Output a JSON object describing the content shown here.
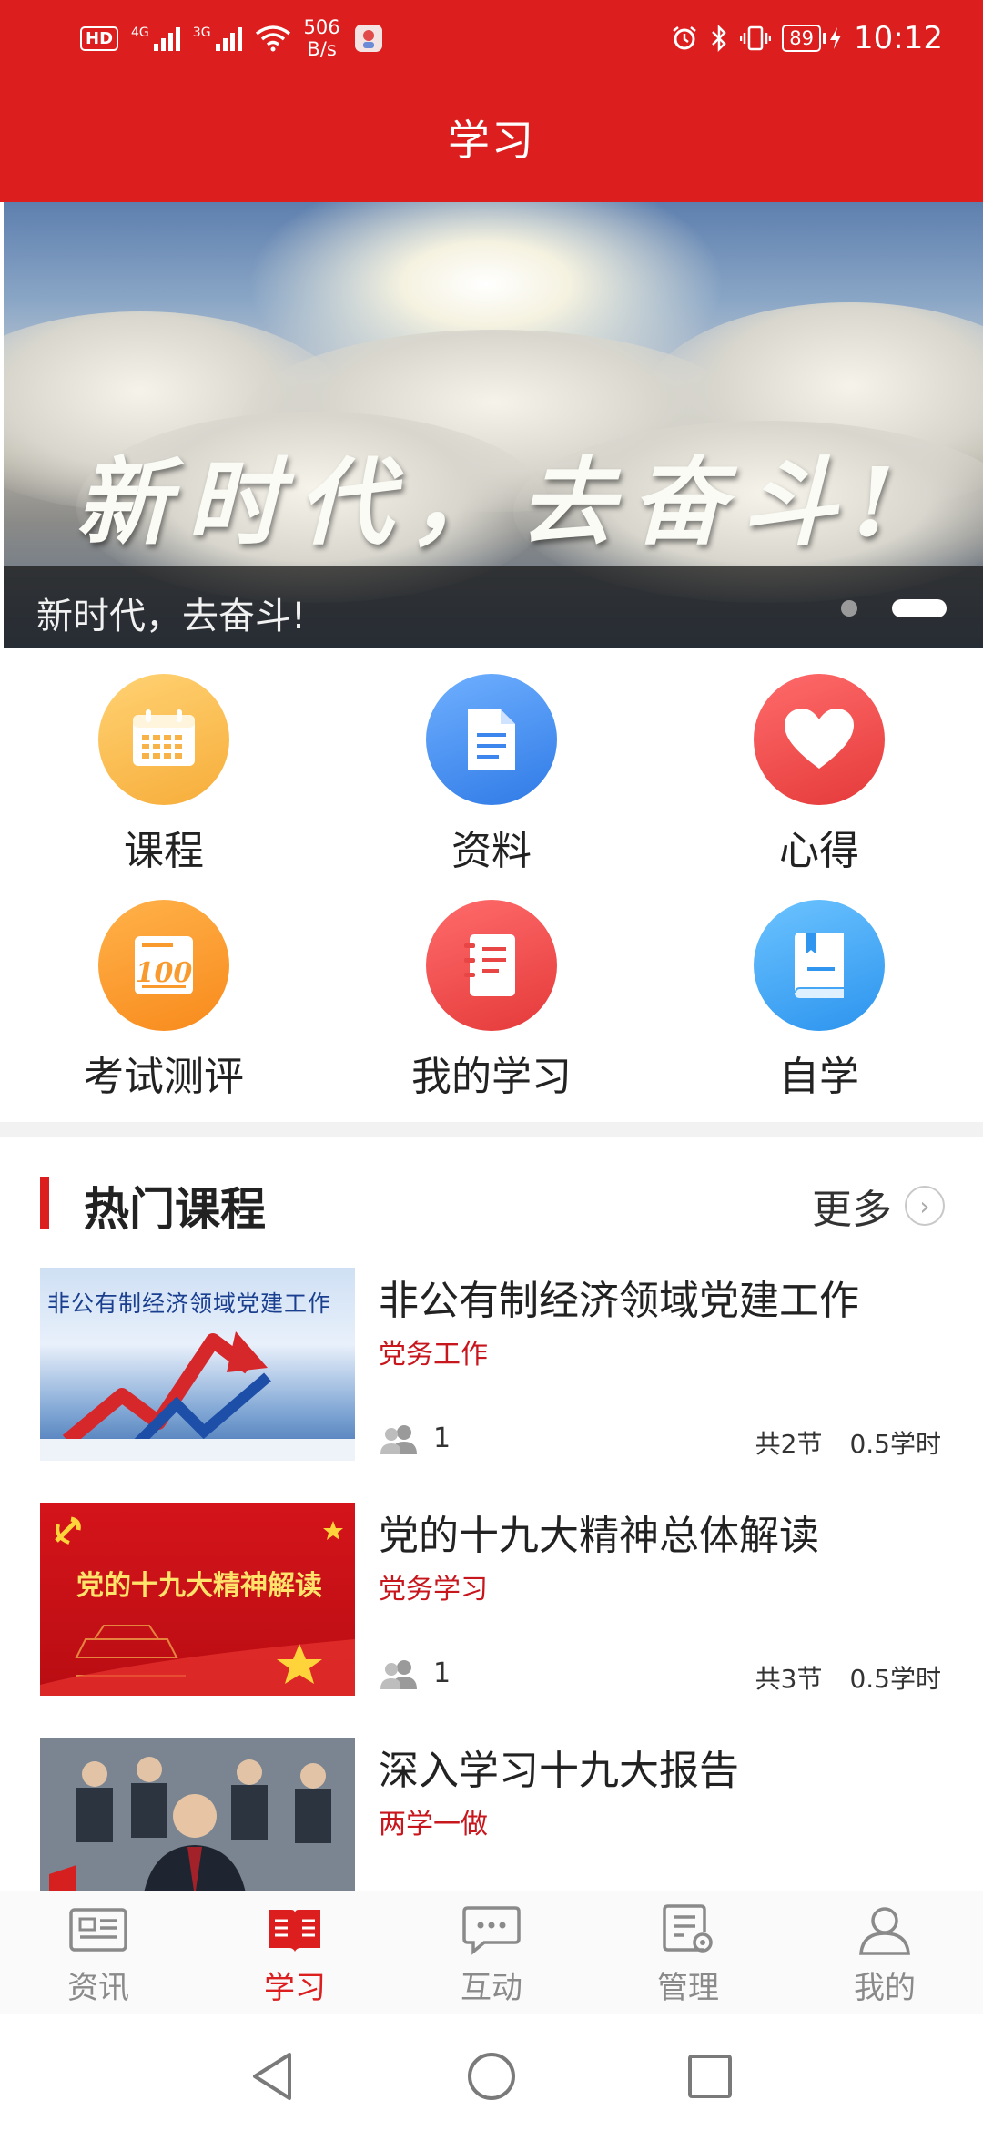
{
  "status_bar": {
    "hd": "HD",
    "sig1": "4G",
    "sig2": "3G",
    "netspeed_value": "506",
    "netspeed_unit": "B/s",
    "battery": "89",
    "time": "10:12"
  },
  "header": {
    "title": "学习"
  },
  "banner": {
    "art_text": "新时代，去奋斗!",
    "caption": "新时代，去奋斗!",
    "slide_count": 2,
    "active_slide": 2
  },
  "grid": {
    "items": [
      {
        "label": "课程",
        "icon": "calendar-icon"
      },
      {
        "label": "资料",
        "icon": "document-icon"
      },
      {
        "label": "心得",
        "icon": "heart-icon"
      },
      {
        "label": "考试测评",
        "icon": "score-100-icon"
      },
      {
        "label": "我的学习",
        "icon": "notebook-icon"
      },
      {
        "label": "自学",
        "icon": "book-icon"
      }
    ]
  },
  "section": {
    "title": "热门课程",
    "more": "更多"
  },
  "courses": [
    {
      "title": "非公有制经济领域党建工作",
      "category": "党务工作",
      "people": "1",
      "sections": "共2节",
      "hours": "0.5学时",
      "thumb_text": "非公有制经济领域党建工作"
    },
    {
      "title": "党的十九大精神总体解读",
      "category": "党务学习",
      "people": "1",
      "sections": "共3节",
      "hours": "0.5学时",
      "thumb_text": "党的十九大精神解读"
    },
    {
      "title": "深入学习十九大报告",
      "category": "两学一做"
    }
  ],
  "bottom_nav": {
    "items": [
      {
        "label": "资讯",
        "icon": "news-icon"
      },
      {
        "label": "学习",
        "icon": "study-icon",
        "active": true
      },
      {
        "label": "互动",
        "icon": "chat-icon"
      },
      {
        "label": "管理",
        "icon": "manage-icon"
      },
      {
        "label": "我的",
        "icon": "profile-icon"
      }
    ]
  },
  "colors": {
    "primary": "#dc1e1e",
    "category": "#c8161d",
    "nav_inactive": "#8a8a8a"
  }
}
